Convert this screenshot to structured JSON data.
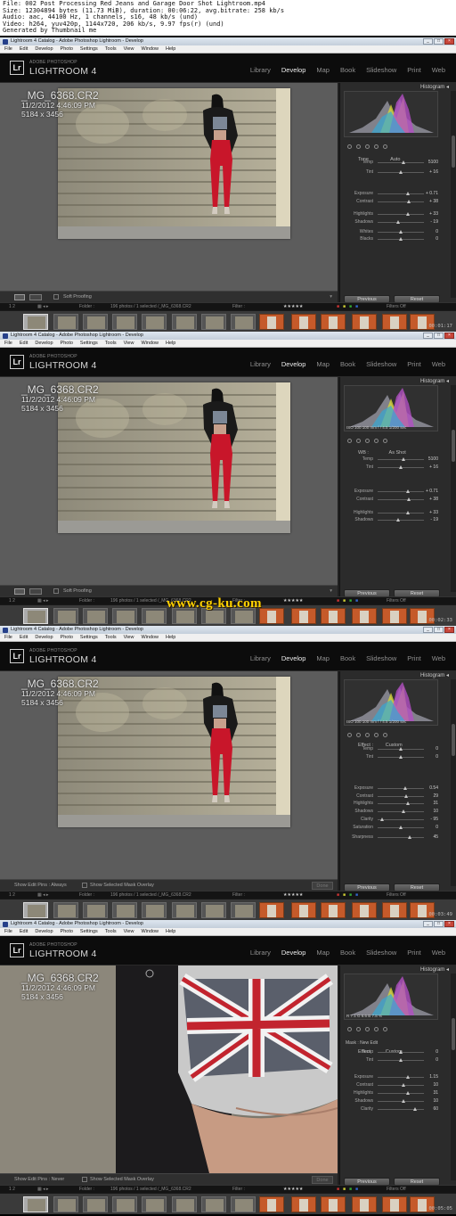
{
  "info": [
    "File: 002 Post Processing Red Jeans and Garage Door Shot Lightroom.mp4",
    "Size: 12304894 bytes (11.73 MiB), duration: 00:06:22, avg.bitrate: 258 kb/s",
    "Audio: aac, 44100 Hz, 1 channels, s16, 48 kb/s (und)",
    "Video: h264, yuv420p, 1144x720, 206 kb/s, 9.97 fps(r) (und)",
    "Generated by Thumbnail me"
  ],
  "window_title": "Lightroom 4 Catalog - Adobe Photoshop Lightroom - Develop",
  "menu": [
    "File",
    "Edit",
    "Develop",
    "Photo",
    "Settings",
    "Tools",
    "View",
    "Window",
    "Help"
  ],
  "brand_sub": "ADOBE PHOTOSHOP",
  "brand": "LIGHTROOM 4",
  "logo": "Lr",
  "modules": [
    "Library",
    "Develop",
    "Map",
    "Book",
    "Slideshow",
    "Print",
    "Web"
  ],
  "active_module": "Develop",
  "file": {
    "name": "_MG_6368.CR2",
    "date": "11/2/2012 4:46:09 PM",
    "dims": "5184 x 3456"
  },
  "histogram_label": "Histogram",
  "filmstrip": {
    "pages": "1  2",
    "folder": "Folder :",
    "count": "196 photos / 1 selected /_MG_6368.CR2",
    "filter_label": "Filter :",
    "filters_off": "Filters Off"
  },
  "buttons": {
    "previous": "Previous",
    "reset": "Reset",
    "done": "Done"
  },
  "watermark": "www.cg-ku.com",
  "colors": {
    "accent": "#ffd200",
    "panel": "#2b2b2b",
    "canvas": "#5c5c5c",
    "jeans": "#c8162a"
  },
  "frames": [
    {
      "timecode": "00:01:17",
      "bottom": "Soft Proofing",
      "exif": "",
      "subheader": "Tone                Auto",
      "sliders": [
        {
          "label": "Temp",
          "value": "5100"
        },
        {
          "label": "Tint",
          "value": "+ 16"
        },
        {
          "label": "Exposure",
          "value": "+ 0.71"
        },
        {
          "label": "Contrast",
          "value": "+ 38"
        },
        {
          "label": "Highlights",
          "value": "+ 33"
        },
        {
          "label": "Shadows",
          "value": "- 19"
        },
        {
          "label": "Whites",
          "value": "0"
        },
        {
          "label": "Blacks",
          "value": "0"
        }
      ]
    },
    {
      "timecode": "00:02:33",
      "bottom": "Soft Proofing",
      "exif": "ISO 100     100 mm     f / 4.5     1/200 sec",
      "subheader": "WB :               As Shot",
      "sliders": [
        {
          "label": "Temp",
          "value": "5100"
        },
        {
          "label": "Tint",
          "value": "+ 16"
        },
        {
          "label": "Exposure",
          "value": "+ 0.71"
        },
        {
          "label": "Contrast",
          "value": "+ 38"
        },
        {
          "label": "Highlights",
          "value": "+ 33"
        },
        {
          "label": "Shadows",
          "value": "- 19"
        }
      ]
    },
    {
      "timecode": "00:03:49",
      "bottom": "Show Edit Pins :    Always",
      "overlay": "Show Selected Mask Overlay",
      "exif": "ISO 100     100 mm     f / 4.5     1/200 sec",
      "subheader": "Effect :         Custom",
      "sliders": [
        {
          "label": "Temp",
          "value": "0"
        },
        {
          "label": "Tint",
          "value": "0"
        },
        {
          "label": "Exposure",
          "value": "0.54"
        },
        {
          "label": "Contrast",
          "value": "29"
        },
        {
          "label": "Highlights",
          "value": "31"
        },
        {
          "label": "Shadows",
          "value": "10"
        },
        {
          "label": "Clarity",
          "value": "- 95"
        },
        {
          "label": "Saturation",
          "value": "0"
        },
        {
          "label": "Sharpness",
          "value": "45"
        }
      ]
    },
    {
      "timecode": "00:05:05",
      "bottom": "Show Edit Pins :    Never",
      "overlay": "Show Selected Mask Overlay",
      "exif": "R   7.1   G   6.6   B   7.8 %",
      "mask": "Mask :                    New     Edit",
      "subheader": "Effect :         Custom",
      "sliders": [
        {
          "label": "Temp",
          "value": "0"
        },
        {
          "label": "Tint",
          "value": "0"
        },
        {
          "label": "Exposure",
          "value": "1.15"
        },
        {
          "label": "Contrast",
          "value": "10"
        },
        {
          "label": "Highlights",
          "value": "31"
        },
        {
          "label": "Shadows",
          "value": "10"
        },
        {
          "label": "Clarity",
          "value": "60"
        }
      ]
    }
  ]
}
